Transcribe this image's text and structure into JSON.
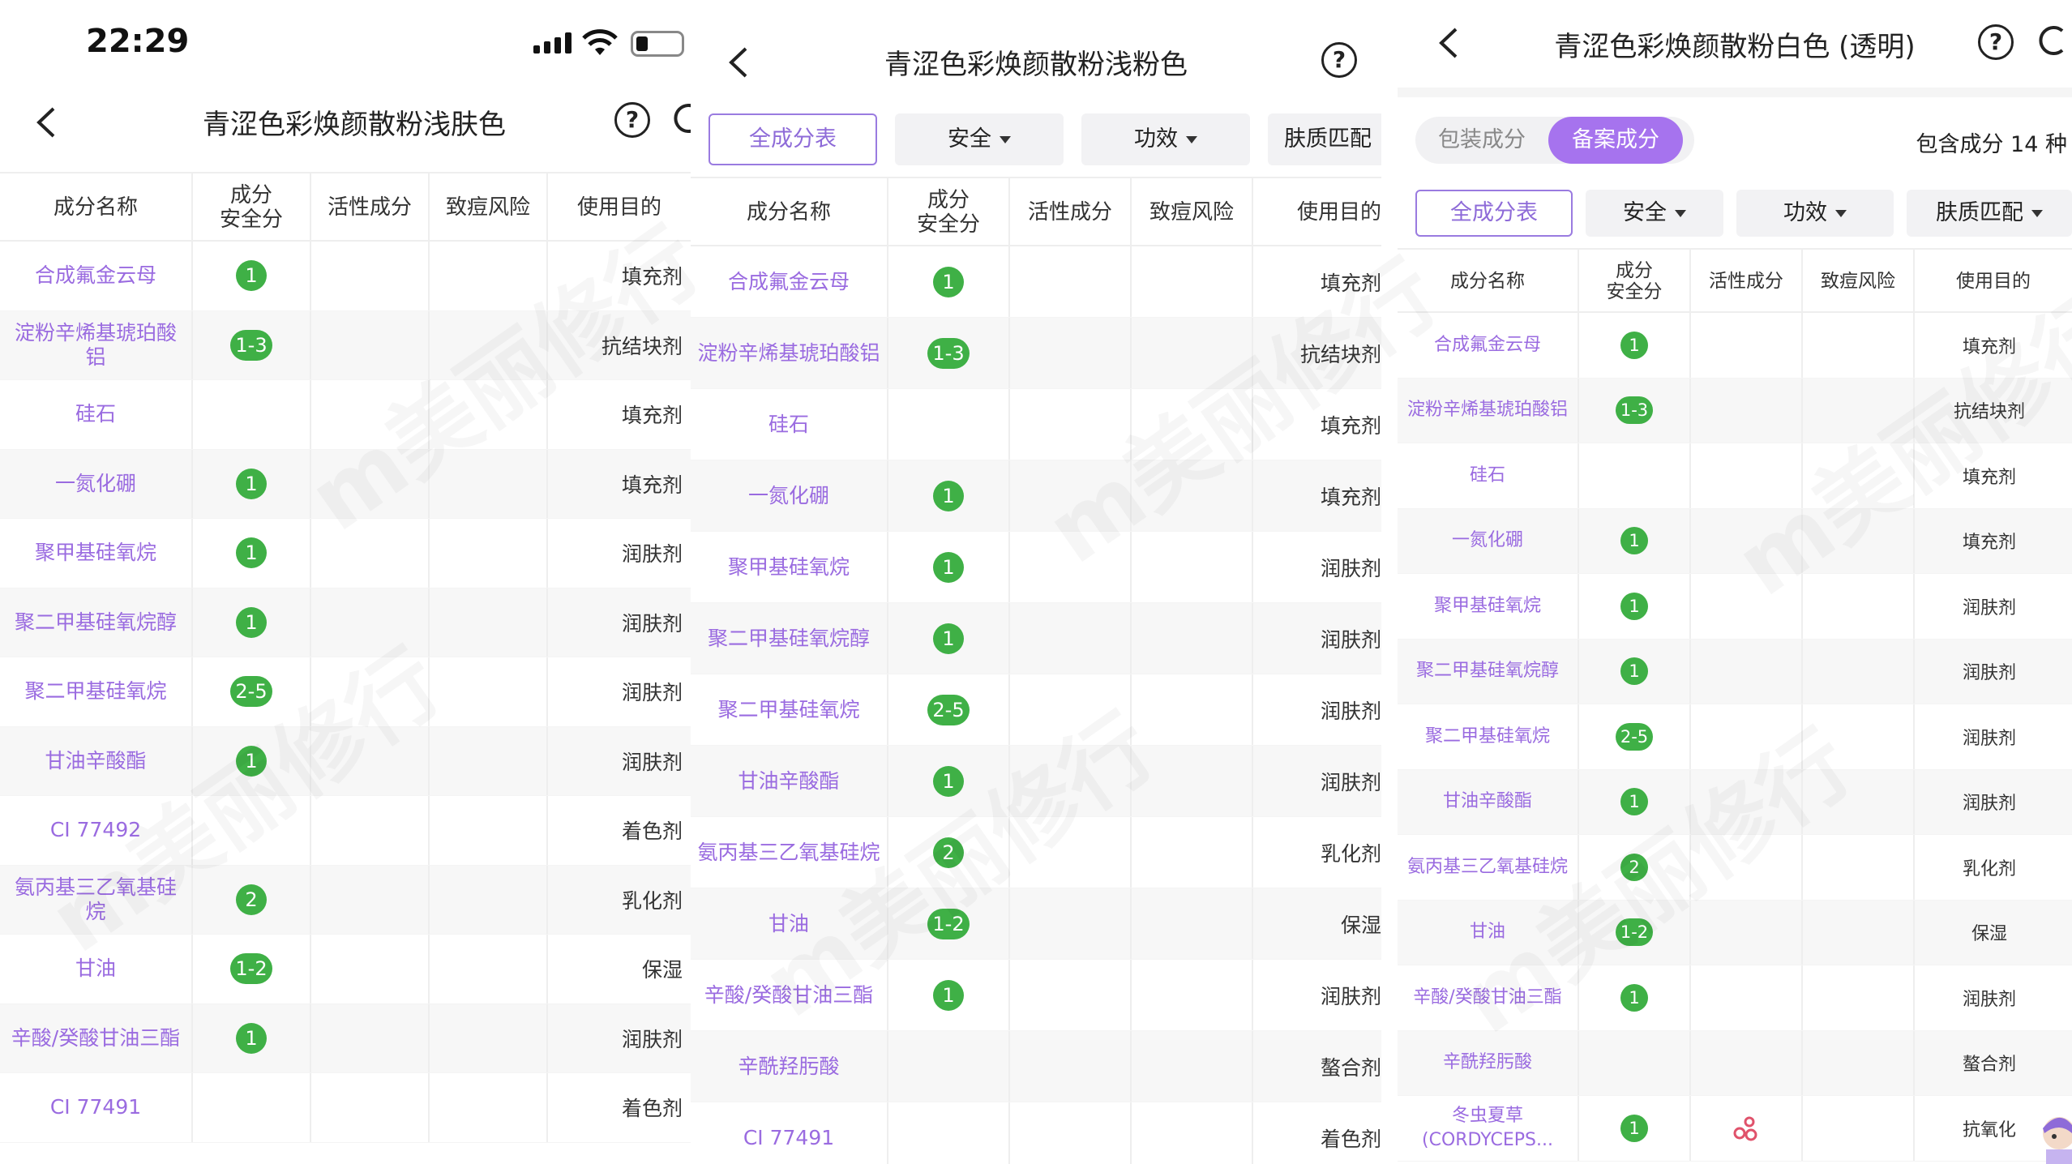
{
  "status": {
    "time": "22:29"
  },
  "panels": {
    "p1": {
      "title": "青涩色彩焕颜散粉浅肤色",
      "headers": {
        "name": "成分名称",
        "safety": "成分\n安全分",
        "active": "活性成分",
        "acne": "致痘风险",
        "purpose": "使用目的"
      },
      "rows": [
        {
          "name": "合成氟金云母",
          "safety": "1",
          "purpose": "填充剂"
        },
        {
          "name": "淀粉辛烯基琥珀酸铝",
          "safety": "1-3",
          "purpose": "抗结块剂"
        },
        {
          "name": "硅石",
          "safety": "",
          "purpose": "填充剂"
        },
        {
          "name": "一氮化硼",
          "safety": "1",
          "purpose": "填充剂"
        },
        {
          "name": "聚甲基硅氧烷",
          "safety": "1",
          "purpose": "润肤剂"
        },
        {
          "name": "聚二甲基硅氧烷醇",
          "safety": "1",
          "purpose": "润肤剂"
        },
        {
          "name": "聚二甲基硅氧烷",
          "safety": "2-5",
          "purpose": "润肤剂"
        },
        {
          "name": "甘油辛酸酯",
          "safety": "1",
          "purpose": "润肤剂"
        },
        {
          "name": "CI 77492",
          "safety": "",
          "purpose": "着色剂"
        },
        {
          "name": "氨丙基三乙氧基硅烷",
          "safety": "2",
          "purpose": "乳化剂"
        },
        {
          "name": "甘油",
          "safety": "1-2",
          "purpose": "保湿"
        },
        {
          "name": "辛酸/癸酸甘油三酯",
          "safety": "1",
          "purpose": "润肤剂"
        },
        {
          "name": "CI 77491",
          "safety": "",
          "purpose": "着色剂"
        }
      ]
    },
    "p2": {
      "title": "青涩色彩焕颜散粉浅粉色",
      "filters": {
        "all": "全成分表",
        "safe": "安全",
        "effect": "功效",
        "skin": "肤质匹配"
      },
      "headers": {
        "name": "成分名称",
        "safety": "成分\n安全分",
        "active": "活性成分",
        "acne": "致痘风险",
        "purpose": "使用目的"
      },
      "rows": [
        {
          "name": "合成氟金云母",
          "safety": "1",
          "purpose": "填充剂"
        },
        {
          "name": "淀粉辛烯基琥珀酸铝",
          "safety": "1-3",
          "purpose": "抗结块剂"
        },
        {
          "name": "硅石",
          "safety": "",
          "purpose": "填充剂"
        },
        {
          "name": "一氮化硼",
          "safety": "1",
          "purpose": "填充剂"
        },
        {
          "name": "聚甲基硅氧烷",
          "safety": "1",
          "purpose": "润肤剂"
        },
        {
          "name": "聚二甲基硅氧烷醇",
          "safety": "1",
          "purpose": "润肤剂"
        },
        {
          "name": "聚二甲基硅氧烷",
          "safety": "2-5",
          "purpose": "润肤剂"
        },
        {
          "name": "甘油辛酸酯",
          "safety": "1",
          "purpose": "润肤剂"
        },
        {
          "name": "氨丙基三乙氧基硅烷",
          "safety": "2",
          "purpose": "乳化剂"
        },
        {
          "name": "甘油",
          "safety": "1-2",
          "purpose": "保湿"
        },
        {
          "name": "辛酸/癸酸甘油三酯",
          "safety": "1",
          "purpose": "润肤剂"
        },
        {
          "name": "辛酰羟肟酸",
          "safety": "",
          "purpose": "螯合剂"
        },
        {
          "name": "CI 77491",
          "safety": "",
          "purpose": "着色剂"
        }
      ]
    },
    "p3": {
      "title": "青涩色彩焕颜散粉白色 (透明)",
      "segments": {
        "pack": "包装成分",
        "record": "备案成分"
      },
      "count": "包含成分 14 种",
      "filters": {
        "all": "全成分表",
        "safe": "安全",
        "effect": "功效",
        "skin": "肤质匹配"
      },
      "headers": {
        "name": "成分名称",
        "safety": "成分\n安全分",
        "active": "活性成分",
        "acne": "致痘风险",
        "purpose": "使用目的"
      },
      "rows": [
        {
          "name": "合成氟金云母",
          "safety": "1",
          "purpose": "填充剂"
        },
        {
          "name": "淀粉辛烯基琥珀酸铝",
          "safety": "1-3",
          "purpose": "抗结块剂"
        },
        {
          "name": "硅石",
          "safety": "",
          "purpose": "填充剂"
        },
        {
          "name": "一氮化硼",
          "safety": "1",
          "purpose": "填充剂"
        },
        {
          "name": "聚甲基硅氧烷",
          "safety": "1",
          "purpose": "润肤剂"
        },
        {
          "name": "聚二甲基硅氧烷醇",
          "safety": "1",
          "purpose": "润肤剂"
        },
        {
          "name": "聚二甲基硅氧烷",
          "safety": "2-5",
          "purpose": "润肤剂"
        },
        {
          "name": "甘油辛酸酯",
          "safety": "1",
          "purpose": "润肤剂"
        },
        {
          "name": "氨丙基三乙氧基硅烷",
          "safety": "2",
          "purpose": "乳化剂"
        },
        {
          "name": "甘油",
          "safety": "1-2",
          "purpose": "保湿"
        },
        {
          "name": "辛酸/癸酸甘油三酯",
          "safety": "1",
          "purpose": "润肤剂"
        },
        {
          "name": "辛酰羟肟酸",
          "safety": "",
          "purpose": "螯合剂"
        },
        {
          "name": "冬虫夏草(CORDYCEPS...",
          "safety": "1",
          "purpose": "抗氧化",
          "active": "molecule-icon"
        }
      ]
    }
  },
  "colors": {
    "accent": "#9a6be0",
    "badge": "#3fb046",
    "segment_active": "#a673ee"
  }
}
